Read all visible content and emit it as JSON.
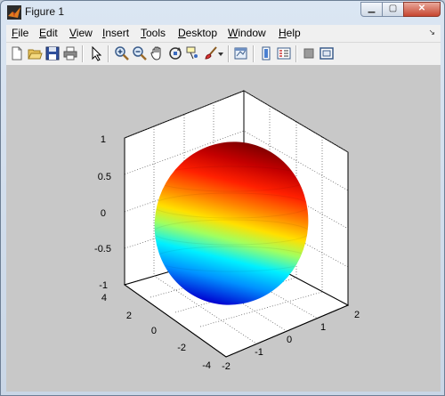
{
  "window": {
    "title": "Figure 1"
  },
  "window_controls": {
    "minimize": "▁",
    "maximize": "▢",
    "close": "✕"
  },
  "menu": {
    "items": [
      {
        "key": "F",
        "rest": "ile"
      },
      {
        "key": "E",
        "rest": "dit"
      },
      {
        "key": "V",
        "rest": "iew"
      },
      {
        "key": "I",
        "rest": "nsert"
      },
      {
        "key": "T",
        "rest": "ools"
      },
      {
        "key": "D",
        "rest": "esktop"
      },
      {
        "key": "W",
        "rest": "indow"
      },
      {
        "key": "H",
        "rest": "elp"
      }
    ],
    "overflow_arrow": "↘"
  },
  "toolbar": {
    "icons": [
      "new-figure-icon",
      "open-file-icon",
      "save-icon",
      "print-icon",
      "edit-plot-arrow-icon",
      "zoom-in-icon",
      "zoom-out-icon",
      "pan-hand-icon",
      "rotate-3d-icon",
      "data-cursor-icon",
      "brush-icon",
      "brush-dropdown-icon",
      "link-plot-icon",
      "insert-colorbar-icon",
      "insert-legend-icon",
      "hide-plot-tools-icon",
      "show-plot-tools-icon"
    ]
  },
  "plot": {
    "z_ticks": [
      "1",
      "0.5",
      "0",
      "-0.5",
      "-1"
    ],
    "y_ticks": [
      "4",
      "2",
      "0",
      "-2",
      "-4"
    ],
    "x_ticks": [
      "-2",
      "-1",
      "0",
      "1",
      "2"
    ],
    "colormap": "jet",
    "surface": "sphere",
    "grid": true
  }
}
